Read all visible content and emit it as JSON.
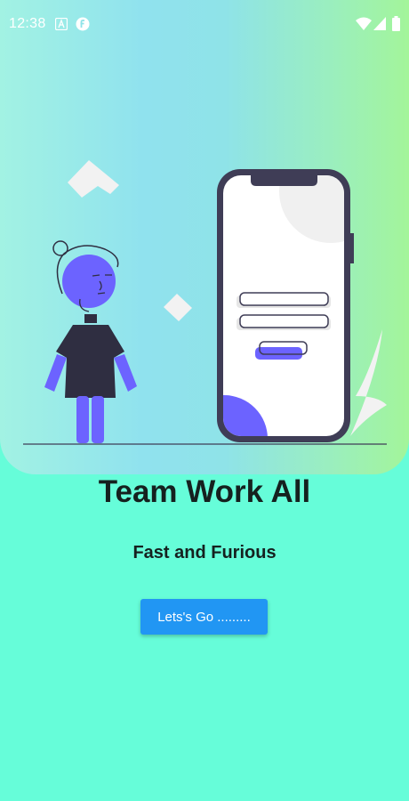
{
  "status_bar": {
    "time": "12:38",
    "left_icons": [
      "font-icon",
      "app-f-icon"
    ],
    "right_icons": [
      "wifi-icon",
      "cell-signal-icon",
      "battery-icon"
    ]
  },
  "hero": {
    "illustration": "person-with-phone-login-illustration",
    "colors": {
      "gradient_start": "#a2f2e3",
      "gradient_end": "#a3f59a",
      "accent": "#6c63ff",
      "phone_frame": "#3f3d56"
    }
  },
  "content": {
    "title": "Team Work All",
    "subtitle": "Fast and Furious",
    "button_label": "Lets's Go ........."
  },
  "colors": {
    "background": "#66fdd9",
    "button": "#2196f3",
    "text": "#15211f"
  }
}
